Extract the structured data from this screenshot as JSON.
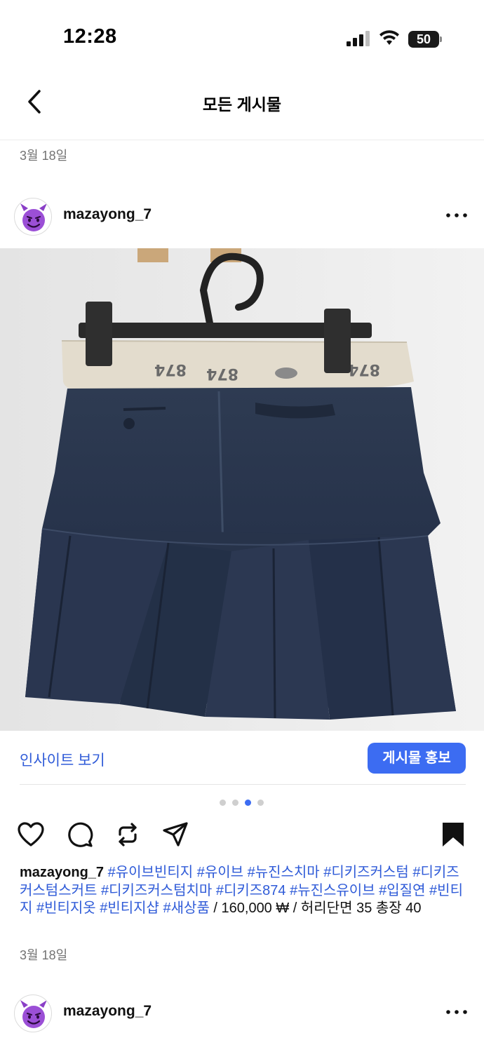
{
  "status_bar": {
    "time": "12:28",
    "battery": "50"
  },
  "header": {
    "title": "모든 게시물"
  },
  "posts": [
    {
      "date": "3월 18일",
      "username": "mazayong_7",
      "insight_label": "인사이트 보기",
      "promote_label": "게시물 홍보",
      "carousel": {
        "count": 4,
        "active_index": 2
      },
      "caption": {
        "username": "mazayong_7",
        "hashtags": "#유이브빈티지 #유이브 #뉴진스치마 #디키즈커스텀 #디키즈커스텀스커트 #디키즈커스텀치마 #디키즈874 #뉴진스유이브 #입질연 #빈티지 #빈티지옷 #빈티지샵 #새상품",
        "text": " / 160,000 ₩ / 허리단면 35 총장 40"
      },
      "post_date": "3월 18일"
    },
    {
      "username": "mazayong_7"
    }
  ],
  "colors": {
    "accent": "#3c6cf2",
    "link": "#2f5bd8",
    "muted": "#737373"
  }
}
